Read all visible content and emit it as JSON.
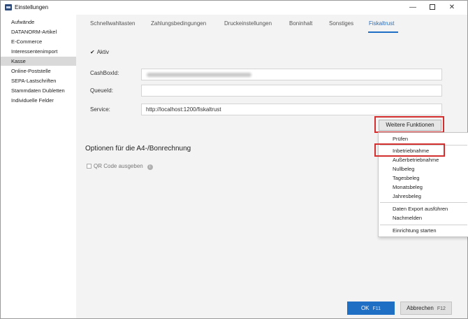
{
  "window": {
    "title": "Einstellungen",
    "minimize": "—",
    "close": "✕"
  },
  "sidebar": {
    "items": [
      {
        "label": "Aufwände"
      },
      {
        "label": "DATANORM-Artikel"
      },
      {
        "label": "E-Commerce"
      },
      {
        "label": "Interessentenimport"
      },
      {
        "label": "Kasse",
        "active": true
      },
      {
        "label": "Online-Poststelle"
      },
      {
        "label": "SEPA-Lastschriften"
      },
      {
        "label": "Stammdaten Dubletten"
      },
      {
        "label": "Individuelle Felder"
      }
    ]
  },
  "tabs": [
    {
      "label": "Schnellwahltasten"
    },
    {
      "label": "Zahlungsbedingungen"
    },
    {
      "label": "Druckeinstellungen"
    },
    {
      "label": "Boninhalt"
    },
    {
      "label": "Sonstiges"
    },
    {
      "label": "Fiskaltrust",
      "active": true
    }
  ],
  "form": {
    "aktiv": {
      "checkmark": "✔",
      "label": "Aktiv"
    },
    "cashboxid": {
      "label": "CashBoxId:",
      "value": ""
    },
    "queueid": {
      "label": "QueueId:",
      "value": ""
    },
    "service": {
      "label": "Service:",
      "value": "http://localhost:1200/fiskaltrust"
    },
    "more_button": "Weitere Funktionen",
    "section_title": "Optionen für die A4-/Bonrechnung",
    "qr": {
      "label": "QR Code ausgeben",
      "info_icon": "i"
    }
  },
  "menu": {
    "items": [
      {
        "label": "Prüfen"
      },
      {
        "label": "Inbetriebnahme",
        "highlighted": true
      },
      {
        "label": "Außerbetriebnahme"
      },
      {
        "label": "Nullbeleg"
      },
      {
        "label": "Tagesbeleg"
      },
      {
        "label": "Monatsbeleg"
      },
      {
        "label": "Jahresbeleg"
      },
      {
        "label": "Daten Export ausführen"
      },
      {
        "label": "Nachmelden"
      },
      {
        "label": "Einrichtung starten"
      }
    ]
  },
  "buttons": {
    "ok": {
      "label": "OK",
      "hotkey": "F11"
    },
    "cancel": {
      "label": "Abbrechen",
      "hotkey": "F12"
    }
  },
  "colors": {
    "accent": "#1f6fc5",
    "highlight_box": "#d32f2f",
    "selected_nav": "#d9d9d9"
  }
}
